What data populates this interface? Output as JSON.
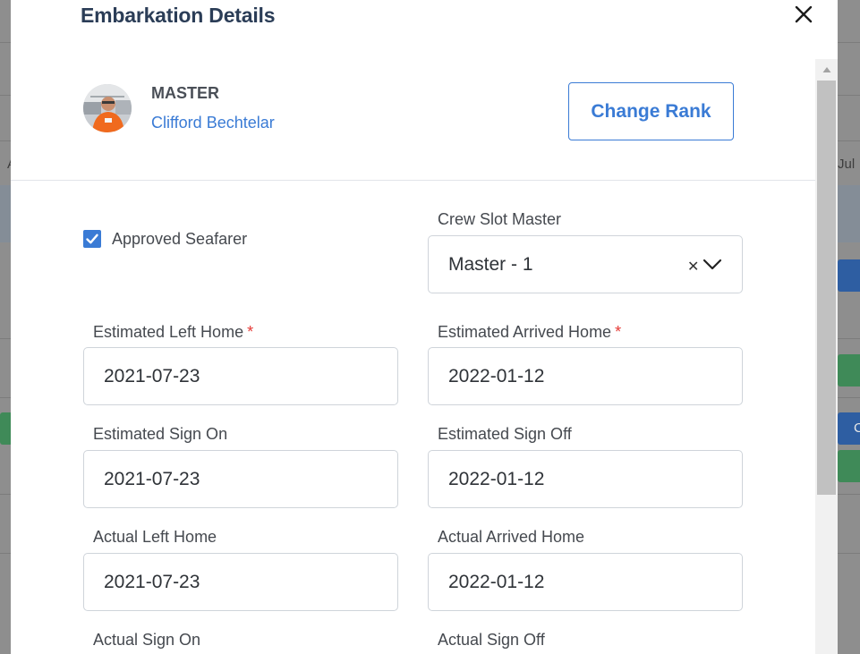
{
  "backdrop": {
    "jul_label": "Jul",
    "a_label": "A",
    "c_label": "C"
  },
  "modal": {
    "title": "Embarkation Details"
  },
  "seafarer": {
    "rank": "MASTER",
    "name": "Clifford Bechtelar",
    "change_rank_label": "Change Rank"
  },
  "approved": {
    "label": "Approved Seafarer",
    "checked": true
  },
  "crew_slot": {
    "label": "Crew Slot Master",
    "value": "Master - 1"
  },
  "fields": {
    "estimated_left_home": {
      "label": "Estimated Left Home",
      "value": "2021-07-23",
      "required": "*"
    },
    "estimated_arrived_home": {
      "label": "Estimated Arrived Home",
      "value": "2022-01-12",
      "required": "*"
    },
    "estimated_sign_on": {
      "label": "Estimated Sign On",
      "value": "2021-07-23"
    },
    "estimated_sign_off": {
      "label": "Estimated Sign Off",
      "value": "2022-01-12"
    },
    "actual_left_home": {
      "label": "Actual Left Home",
      "value": "2021-07-23"
    },
    "actual_arrived_home": {
      "label": "Actual Arrived Home",
      "value": "2022-01-12"
    },
    "actual_sign_on": {
      "label": "Actual Sign On"
    },
    "actual_sign_off": {
      "label": "Actual Sign Off"
    }
  },
  "colors": {
    "accent": "#3a7bd5",
    "title": "#2b3d57",
    "required": "#e53935"
  }
}
